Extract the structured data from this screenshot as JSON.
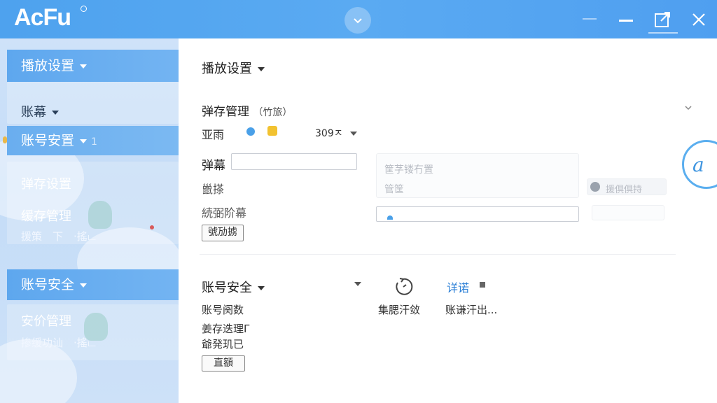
{
  "app": {
    "logo": "AcFu"
  },
  "sidebar": {
    "section1": {
      "label": "播放设置"
    },
    "item_danmu": {
      "label": "账幕"
    },
    "section_account_setup": {
      "label": "账号安置",
      "suffix": "1"
    },
    "item_cache_settings": {
      "label": "弹存设置"
    },
    "item_cache_manage": {
      "label": "缓存管理"
    },
    "item_cache_manage_sub": "援策　下　·搖ட",
    "section_account_security": {
      "label": "账号安全"
    },
    "item_price_manage": {
      "label": "安价管理"
    },
    "item_price_manage_sub": "掺缓功讪　·搖ட"
  },
  "main": {
    "playback": {
      "title": "播放设置"
    },
    "cache": {
      "title": "弹存管理",
      "title_suffix": "（竹旅）",
      "row1_label": "亚雨",
      "row1_value": "309ㅈ",
      "danmu_label": "弹幕",
      "danmu_input_value": "",
      "label2": "巤搽",
      "label3": "続弼阶幕",
      "btn": "號劢掳",
      "faint_box_line1": "筐芓镂冇置",
      "faint_box_line2": "管筐",
      "search_faint": "援倶倶持"
    },
    "security": {
      "title": "账号安全",
      "row1": "账号阕数",
      "row2": "姜存迭理Γ",
      "row3": "爺発玑已",
      "btn": "直額",
      "center_label": "集腮汗敛",
      "link": "详诺",
      "right_label": "账谦汗出..."
    }
  },
  "colors": {
    "titlebar": "#4ea2ee",
    "accent": "#5aaeef",
    "link": "#2b7fd6"
  },
  "icons": {
    "collapse": "chevron-down-icon",
    "minimize": "minimize-icon",
    "maximize": "external-window-icon",
    "close": "close-icon",
    "refresh": "refresh-icon",
    "side_logo": "acfun-circle-icon"
  }
}
